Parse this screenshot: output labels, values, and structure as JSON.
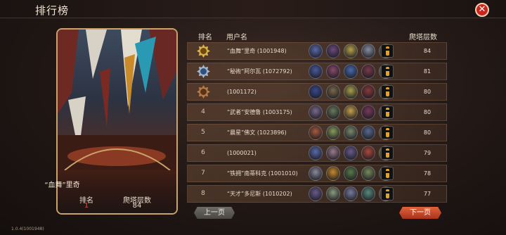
{
  "header": {
    "title": "排行榜"
  },
  "close_icon": "close-icon",
  "card": {
    "player_name": "“血舞”里奇",
    "rank_label": "排名",
    "rank_value": "1",
    "floor_label": "爬塔层数",
    "floor_value": "84"
  },
  "table": {
    "col_rank": "排名",
    "col_user": "用户名",
    "col_floor": "爬塔层数",
    "rows": [
      {
        "rank": "",
        "medal": "gold",
        "name": "“血舞”里奇 (1001948)",
        "floor": "84"
      },
      {
        "rank": "",
        "medal": "silver",
        "name": "“秘術”阿尔瓦 (1072792)",
        "floor": "81"
      },
      {
        "rank": "",
        "medal": "bronze",
        "name": "(1001172)",
        "floor": "80"
      },
      {
        "rank": "4",
        "medal": "",
        "name": "“武者”安德鲁 (1003175)",
        "floor": "80"
      },
      {
        "rank": "5",
        "medal": "",
        "name": "“晨星”佛文 (1023896)",
        "floor": "80"
      },
      {
        "rank": "6",
        "medal": "",
        "name": "(1000021)",
        "floor": "79"
      },
      {
        "rank": "7",
        "medal": "",
        "name": "“铁拥”南蒂科克 (1001010)",
        "floor": "78"
      },
      {
        "rank": "8",
        "medal": "",
        "name": "“天才”多尼斯 (1010202)",
        "floor": "77"
      }
    ]
  },
  "avatar_colors": [
    [
      "#5a6aa8",
      "#6d4a7a",
      "#b7a24a",
      "#8a8fa0",
      "#6a8a5a"
    ],
    [
      "#4a5a9a",
      "#8a4a6a",
      "#4a6aaa",
      "#7a3a4a",
      "#8a8f9a"
    ],
    [
      "#3a4a8a",
      "#7a6a4a",
      "#a8a04a",
      "#8a3a3a",
      "#5a8a6a"
    ],
    [
      "#7a6a8a",
      "#6a7a5a",
      "#c8a24a",
      "#7a3a5a",
      "#6a6a8a"
    ],
    [
      "#a85a3a",
      "#8a9a5a",
      "#7a8a6a",
      "#5a6a8a",
      "#c87a2a"
    ],
    [
      "#5a6aa8",
      "#9a7a8a",
      "#6a5a8a",
      "#aa4a3a",
      "#8a9a4a"
    ],
    [
      "#8a8a9a",
      "#c88a2a",
      "#5a7a4a",
      "#7a8a5a",
      "#4a7a6a"
    ],
    [
      "#6a5a8a",
      "#8a9a7a",
      "#7a7a9a",
      "#5a8a7a",
      "#a87a4a"
    ]
  ],
  "pager": {
    "prev_label": "上一页",
    "next_label": "下一页"
  },
  "version": "1.0.4(1001948)"
}
